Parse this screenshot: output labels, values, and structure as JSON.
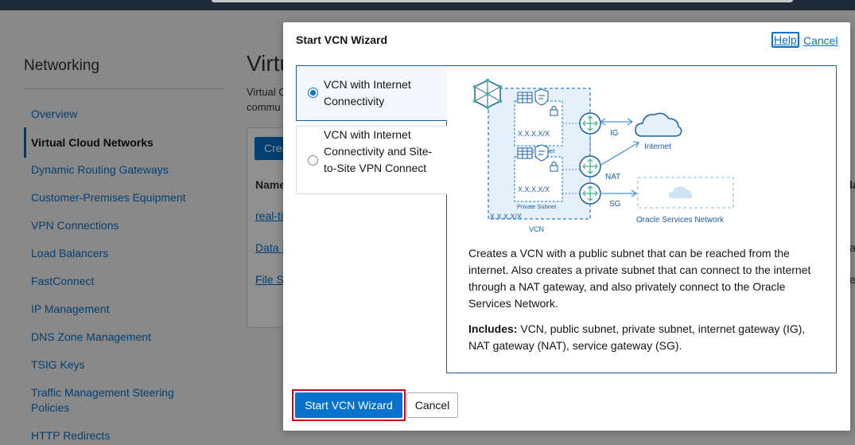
{
  "background": {
    "sidebar": {
      "title": "Networking",
      "items": [
        {
          "label": "Overview",
          "active": false
        },
        {
          "label": "Virtual Cloud Networks",
          "active": true
        },
        {
          "label": "Dynamic Routing Gateways",
          "active": false
        },
        {
          "label": "Customer-Premises Equipment",
          "active": false
        },
        {
          "label": "VPN Connections",
          "active": false
        },
        {
          "label": "Load Balancers",
          "active": false
        },
        {
          "label": "FastConnect",
          "active": false
        },
        {
          "label": "IP Management",
          "active": false
        },
        {
          "label": "DNS Zone Management",
          "active": false
        },
        {
          "label": "TSIG Keys",
          "active": false
        },
        {
          "label": "Traffic Management Steering Policies",
          "active": false
        },
        {
          "label": "HTTP Redirects",
          "active": false
        }
      ]
    },
    "main": {
      "title": "Virtu",
      "desc_line1": "Virtual C",
      "desc_line2": "commu",
      "create_button": "Crea",
      "column_header": "Name",
      "rows": [
        "real-ti",
        "Data S",
        "File S"
      ],
      "right_header": "la",
      "right_rows": [
        "a",
        "e"
      ]
    }
  },
  "modal": {
    "title": "Start VCN Wizard",
    "help": "Help",
    "cancel_link": "Cancel",
    "options": [
      {
        "label": "VCN with Internet Connectivity",
        "selected": true
      },
      {
        "label": "VCN with Internet Connectivity and Site-to-Site VPN Connect",
        "selected": false
      }
    ],
    "diagram": {
      "public_subnet": "Public Subnet",
      "private_subnet": "Private Subnet",
      "cidr": "X.X.X.X/X",
      "vcn": "VCN",
      "ig": "IG",
      "nat": "NAT",
      "sg": "SG",
      "internet": "Internet",
      "osn": "Oracle Services Network"
    },
    "description": "Creates a VCN with a public subnet that can be reached from the internet. Also creates a private subnet that can connect to the internet through a NAT gateway, and also privately connect to the Oracle Services Network.",
    "includes_label": "Includes:",
    "includes_text": "VCN, public subnet, private subnet, internet gateway (IG), NAT gateway (NAT), service gateway (SG).",
    "primary_button": "Start VCN Wizard",
    "secondary_button": "Cancel"
  },
  "colors": {
    "accent": "#0572ce",
    "highlight_border": "#d0021b",
    "topbar": "#1f2b38"
  }
}
